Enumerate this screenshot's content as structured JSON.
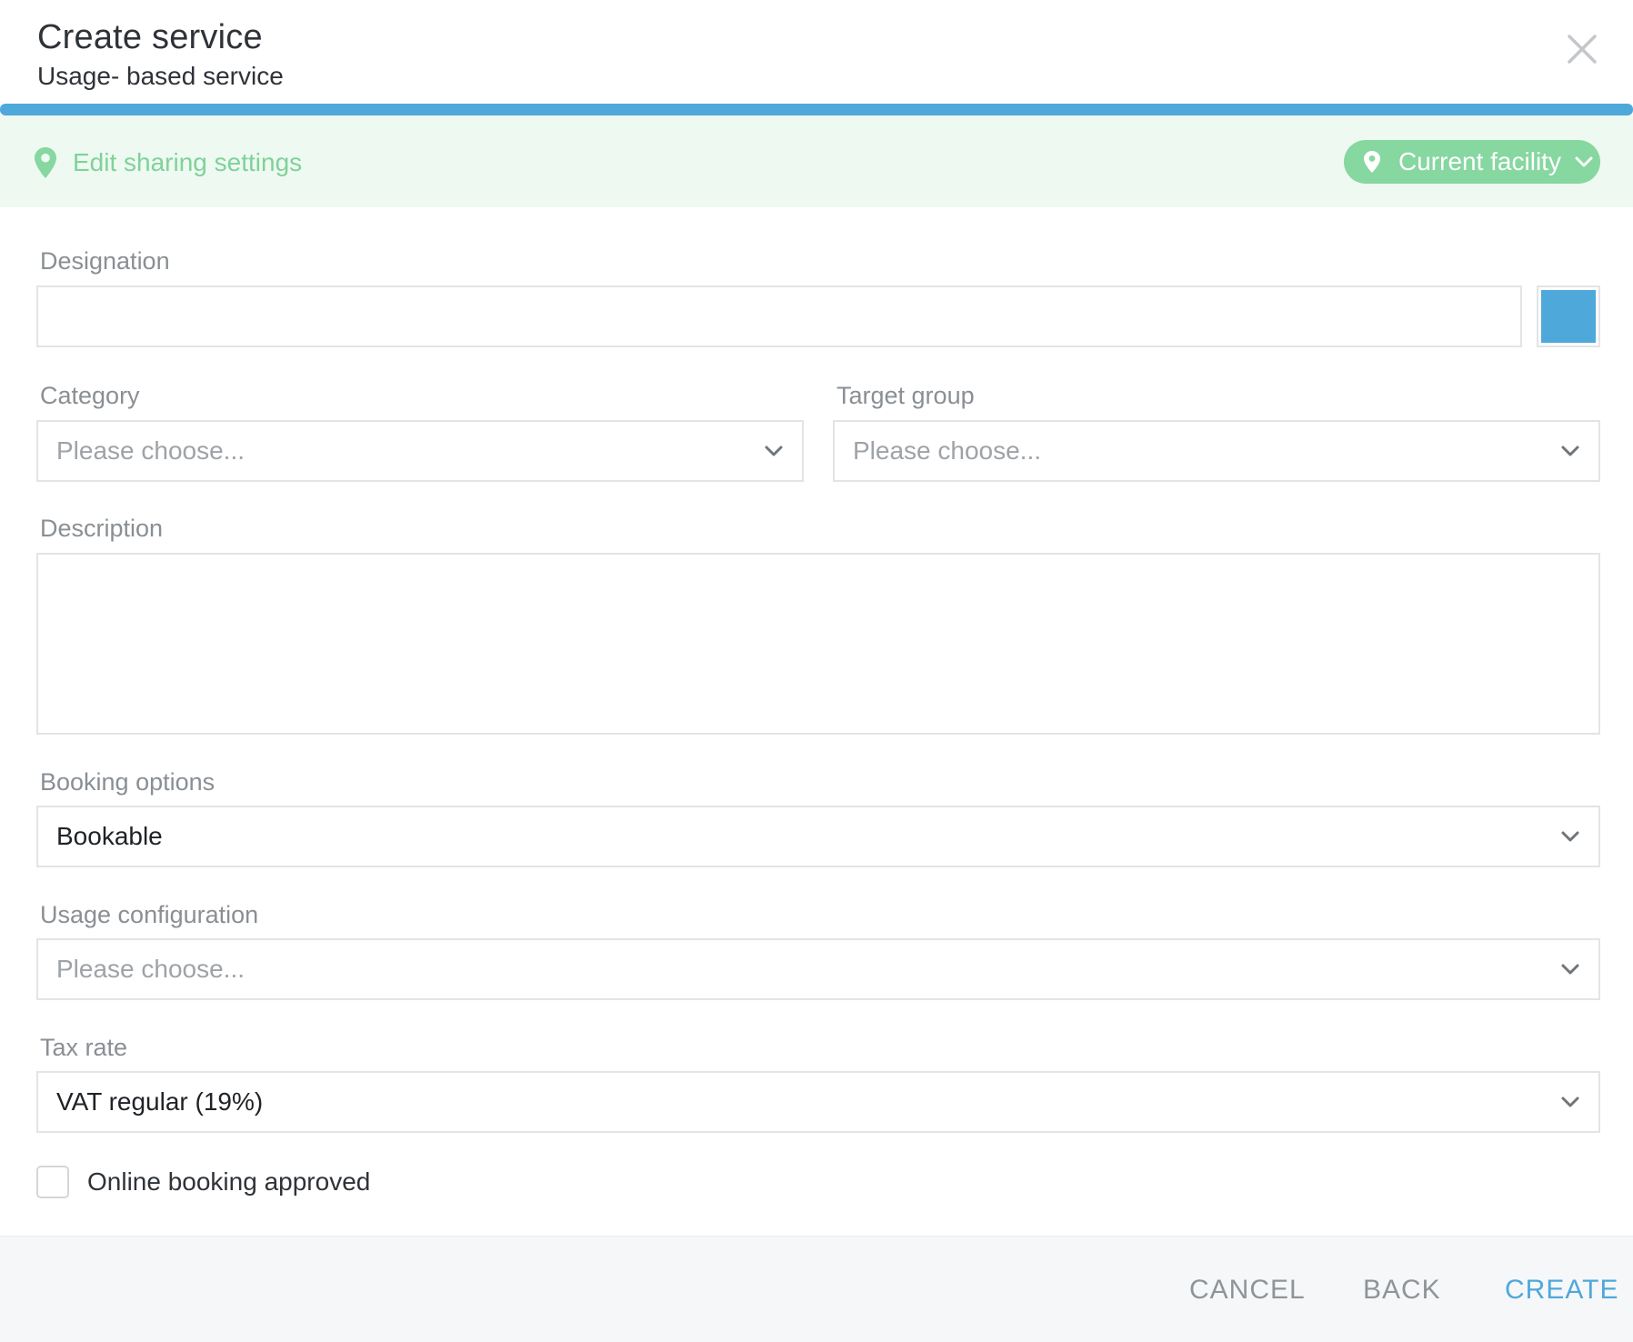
{
  "header": {
    "title": "Create service",
    "subtitle": "Usage- based service"
  },
  "sharing": {
    "link_label": "Edit sharing settings",
    "facility_label": "Current facility"
  },
  "form": {
    "designation": {
      "label": "Designation",
      "value": "",
      "color": "#4fa8da"
    },
    "category": {
      "label": "Category",
      "value": "Please choose..."
    },
    "target_group": {
      "label": "Target group",
      "value": "Please choose..."
    },
    "description": {
      "label": "Description",
      "value": ""
    },
    "booking_options": {
      "label": "Booking options",
      "value": "Bookable"
    },
    "usage_configuration": {
      "label": "Usage configuration",
      "value": "Please choose..."
    },
    "tax_rate": {
      "label": "Tax rate",
      "value": "VAT regular (19%)"
    },
    "online_booking": {
      "label": "Online booking approved",
      "checked": false
    }
  },
  "footer": {
    "cancel_label": "CANCEL",
    "back_label": "BACK",
    "create_label": "CREATE"
  },
  "colors": {
    "accent": "#4fa8da",
    "green": "#86d7a0",
    "green_text": "#7fd29a",
    "share_bg": "#eef9f1"
  }
}
